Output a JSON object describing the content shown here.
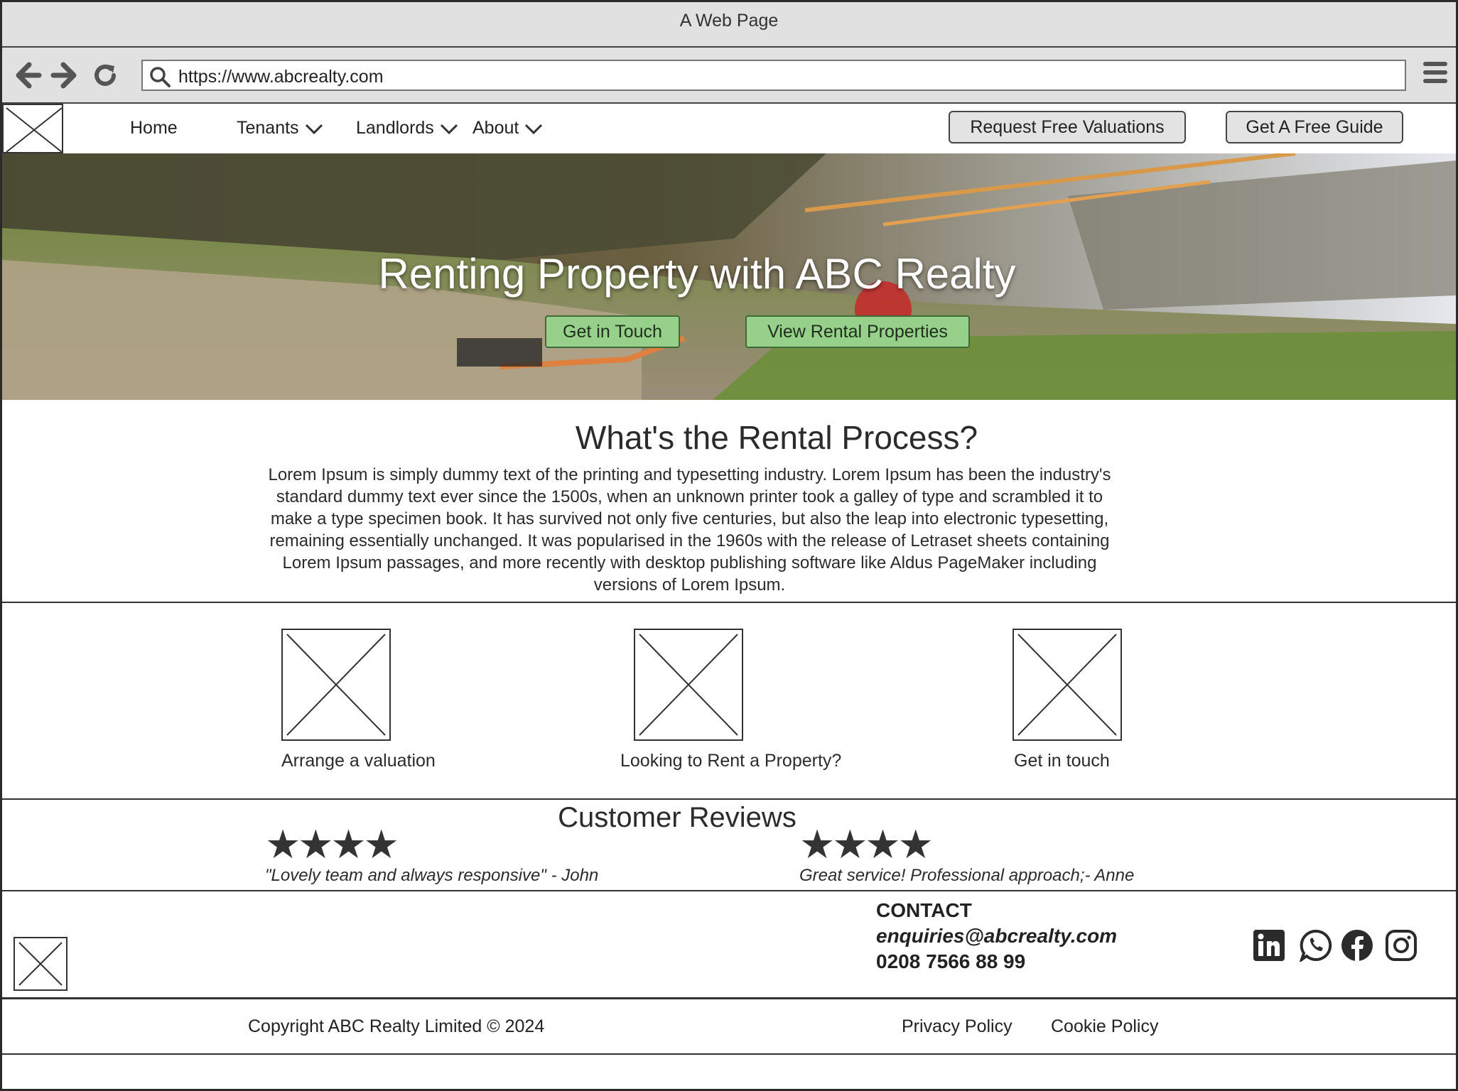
{
  "window": {
    "title": "A Web Page"
  },
  "browser": {
    "url": "https://www.abcrealty.com",
    "icons": [
      "back-arrow-icon",
      "forward-arrow-icon",
      "reload-icon",
      "search-icon",
      "hamburger-menu-icon"
    ]
  },
  "nav": {
    "home": "Home",
    "tenants": "Tenants",
    "landlords": "Landlords",
    "about": "About",
    "request_valuations": "Request Free Valuations",
    "free_guide": "Get A Free Guide"
  },
  "hero": {
    "title": "Renting Property with ABC Realty",
    "get_in_touch": "Get in Touch",
    "view_rentals": "View Rental Properties"
  },
  "process": {
    "title": "What's the Rental Process?",
    "body": "Lorem Ipsum is simply dummy text of the printing and typesetting industry. Lorem Ipsum has been the industry's standard dummy text ever since the 1500s, when an unknown printer took a galley of type and scrambled it to make a type specimen book. It has survived not only five centuries, but also the leap into electronic typesetting, remaining essentially unchanged. It was popularised in the 1960s with the release of Letraset sheets containing Lorem Ipsum passages, and more recently with desktop publishing software like Aldus PageMaker including versions of Lorem Ipsum."
  },
  "cards": [
    {
      "label": "Arrange a valuation"
    },
    {
      "label": "Looking to Rent a Property?"
    },
    {
      "label": "Get in touch"
    }
  ],
  "reviews": {
    "title": "Customer Reviews",
    "items": [
      {
        "stars": "★★★★",
        "rating": 4,
        "text": "\"Lovely team and always responsive\" - John"
      },
      {
        "stars": "★★★★",
        "rating": 4,
        "text": "Great service! Professional approach;- Anne"
      }
    ]
  },
  "footer": {
    "contact_heading": "CONTACT",
    "email": "enquiries@abcrealty.com",
    "phone": "0208 7566 88 99",
    "social": [
      "linkedin-icon",
      "whatsapp-icon",
      "facebook-icon",
      "instagram-icon"
    ],
    "copyright": "Copyright ABC Realty Limited © 2024",
    "privacy": "Privacy Policy",
    "cookie": "Cookie Policy"
  },
  "colors": {
    "hero_button": "#96d08a",
    "chrome": "#e1e1e1",
    "border": "#2b2b2b"
  }
}
